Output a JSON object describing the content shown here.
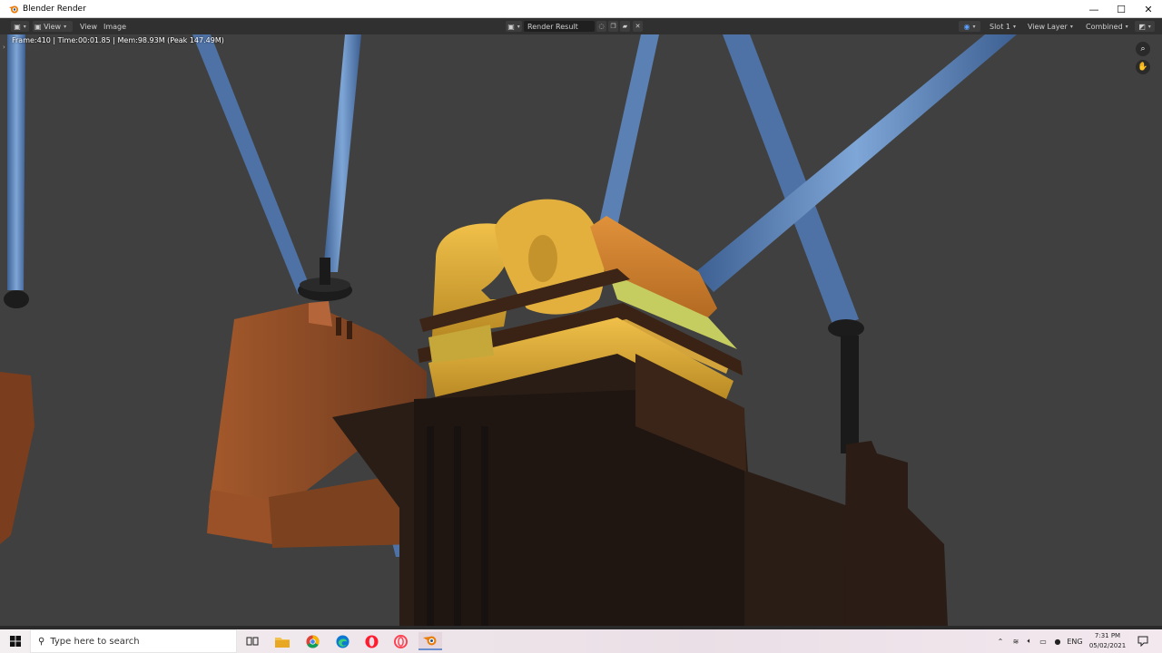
{
  "window": {
    "title": "Blender Render",
    "controls": {
      "minimize": "—",
      "maximize": "☐",
      "close": "✕"
    }
  },
  "header": {
    "view_mode_label": "View",
    "menus": {
      "view": "View",
      "image": "Image"
    },
    "image_name": "Render Result",
    "slot": "Slot 1",
    "view_layer": "View Layer",
    "pass": "Combined"
  },
  "render": {
    "stats": "Frame:410 | Time:00:01.85 | Mem:98.93M (Peak 147.49M)"
  },
  "taskbar": {
    "search_placeholder": "Type here to search",
    "language": "ENG",
    "time": "7:31 PM",
    "date": "05/02/2021",
    "apps": [
      "task-view",
      "file-explorer",
      "chrome",
      "edge",
      "opera",
      "opera-gx",
      "blender"
    ]
  },
  "colors": {
    "header_bg": "#303030",
    "render_bg": "#404040",
    "beam_blue": "#5b80b3",
    "gold": "#d9a832"
  }
}
